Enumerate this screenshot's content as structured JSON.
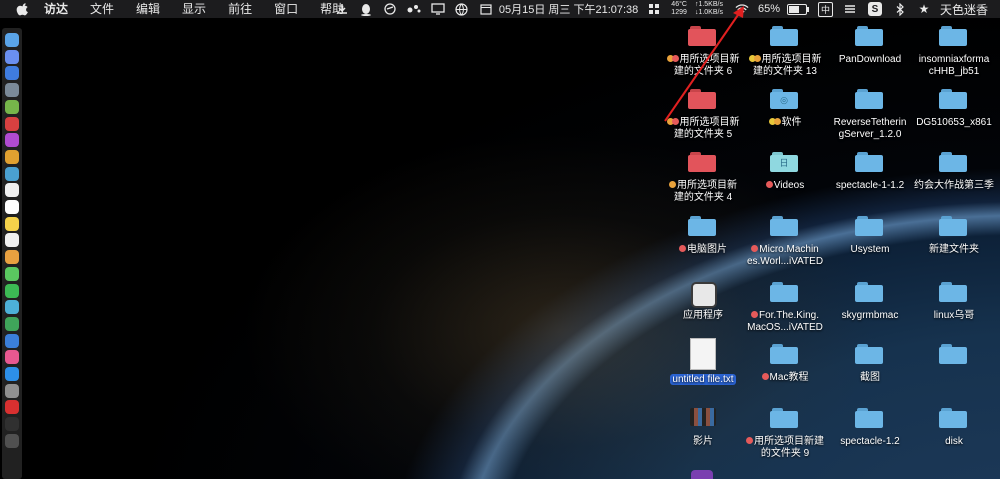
{
  "menubar": {
    "app_name": "访达",
    "menus": [
      "文件",
      "编辑",
      "显示",
      "前往",
      "窗口",
      "帮助"
    ],
    "temp": "46°C",
    "fan": "1299",
    "net_up": "↑1.5KB/s",
    "net_down": "↓1.0KB/s",
    "datetime": "05月15日 周三 下午21:07:38",
    "battery_percent": "65%",
    "input_method": "中",
    "user_name": "天色迷香"
  },
  "colors": {
    "folder_blue": "#6cb6e6",
    "folder_red": "#e2545b",
    "tag_red": "#e55a5a",
    "tag_orange": "#e9a23b",
    "tag_yellow": "#e8c73a",
    "selection": "#2a63d3"
  },
  "desktop": {
    "items": [
      {
        "name": "用所选项目新建的文件夹 6",
        "label_lines": [
          "用所选项目新",
          "建的文件夹 6"
        ],
        "icon": "folder-red",
        "tags": [
          "orange",
          "red"
        ]
      },
      {
        "name": "用所选项目新建的文件夹 13",
        "label_lines": [
          "用所选项目新",
          "建的文件夹 13"
        ],
        "icon": "folder",
        "tags": [
          "yellow",
          "orange"
        ]
      },
      {
        "name": "PanDownload",
        "label_lines": [
          "PanDownload"
        ],
        "icon": "folder",
        "tags": []
      },
      {
        "name": "insomniaxformacHHB_jb51",
        "label_lines": [
          "insomniaxforma",
          "cHHB_jb51"
        ],
        "icon": "folder",
        "tags": []
      },
      {
        "name": "用所选项目新建的文件夹 5",
        "label_lines": [
          "用所选项目新",
          "建的文件夹 5"
        ],
        "icon": "folder-red",
        "tags": [
          "orange",
          "red"
        ]
      },
      {
        "name": "软件",
        "label_lines": [
          "软件"
        ],
        "icon": "folder-apps",
        "tags": [
          "yellow",
          "orange"
        ]
      },
      {
        "name": "ReverseTetheringServer_1.2.0",
        "label_lines": [
          "ReverseTetherin",
          "gServer_1.2.0"
        ],
        "icon": "folder",
        "tags": []
      },
      {
        "name": "DG510653_x861",
        "label_lines": [
          "DG510653_x861"
        ],
        "icon": "folder",
        "tags": []
      },
      {
        "name": "用所选项目新建的文件夹 4",
        "label_lines": [
          "用所选项目新",
          "建的文件夹 4"
        ],
        "icon": "folder-red",
        "tags": [
          "orange"
        ]
      },
      {
        "name": "Videos",
        "label_lines": [
          "Videos"
        ],
        "icon": "folder-cyan",
        "tags": [
          "red"
        ]
      },
      {
        "name": "spectacle-1-1.2",
        "label_lines": [
          "spectacle-1-1.2"
        ],
        "icon": "folder",
        "tags": []
      },
      {
        "name": "约会大作战第三季",
        "label_lines": [
          "约会大作战第三季"
        ],
        "icon": "folder",
        "tags": []
      },
      {
        "name": "电脑图片",
        "label_lines": [
          "电脑图片"
        ],
        "icon": "folder",
        "tags": [
          "red"
        ]
      },
      {
        "name": "Micro.Machines.Worl...iVATED",
        "label_lines": [
          "Micro.Machin",
          "es.Worl...iVATED"
        ],
        "icon": "folder",
        "tags": [
          "red"
        ]
      },
      {
        "name": "Usystem",
        "label_lines": [
          "Usystem"
        ],
        "icon": "folder",
        "tags": []
      },
      {
        "name": "新建文件夹",
        "label_lines": [
          "新建文件夹"
        ],
        "icon": "folder",
        "tags": []
      },
      {
        "name": "应用程序",
        "label_lines": [
          "应用程序"
        ],
        "icon": "app-drive",
        "tags": []
      },
      {
        "name": "For.The.King.MacOS...iVATED",
        "label_lines": [
          "For.The.King.",
          "MacOS...iVATED"
        ],
        "icon": "folder",
        "tags": [
          "red"
        ]
      },
      {
        "name": "skygrmbmac",
        "label_lines": [
          "skygrmbmac"
        ],
        "icon": "folder",
        "tags": []
      },
      {
        "name": "linux乌哥",
        "label_lines": [
          "linux乌哥"
        ],
        "icon": "folder",
        "tags": []
      },
      {
        "name": "untitled file.txt",
        "label_lines": [
          "untitled file.txt"
        ],
        "icon": "txt-file",
        "tags": [],
        "selected": true
      },
      {
        "name": "Mac教程",
        "label_lines": [
          "Mac教程"
        ],
        "icon": "folder",
        "tags": [
          "red"
        ]
      },
      {
        "name": "截图",
        "label_lines": [
          "截图"
        ],
        "icon": "folder",
        "tags": []
      },
      {
        "name": "",
        "label_lines": [],
        "icon": "folder",
        "tags": []
      },
      {
        "name": "影片",
        "label_lines": [
          "影片"
        ],
        "icon": "movie",
        "tags": []
      },
      {
        "name": "用所选项目新建的文件夹 9",
        "label_lines": [
          "用所选项目新建",
          "的文件夹 9"
        ],
        "icon": "folder",
        "tags": [
          "red"
        ]
      },
      {
        "name": "spectacle-1.2",
        "label_lines": [
          "spectacle-1.2"
        ],
        "icon": "folder",
        "tags": []
      },
      {
        "name": "disk",
        "label_lines": [
          "disk"
        ],
        "icon": "folder",
        "tags": []
      },
      {
        "name": "",
        "label_lines": [],
        "icon": "app-purple",
        "tags": []
      }
    ]
  },
  "dock": {
    "items": [
      "finder",
      "siri",
      "safari",
      "browser",
      "android",
      "netease",
      "app1",
      "app2",
      "app3",
      "app4",
      "calendar",
      "notes",
      "reminders",
      "photos",
      "messages",
      "facetime",
      "maps",
      "numbers",
      "keynote",
      "itunes",
      "appstore",
      "preferences",
      "vivaldi",
      "terminal",
      "screen"
    ]
  }
}
